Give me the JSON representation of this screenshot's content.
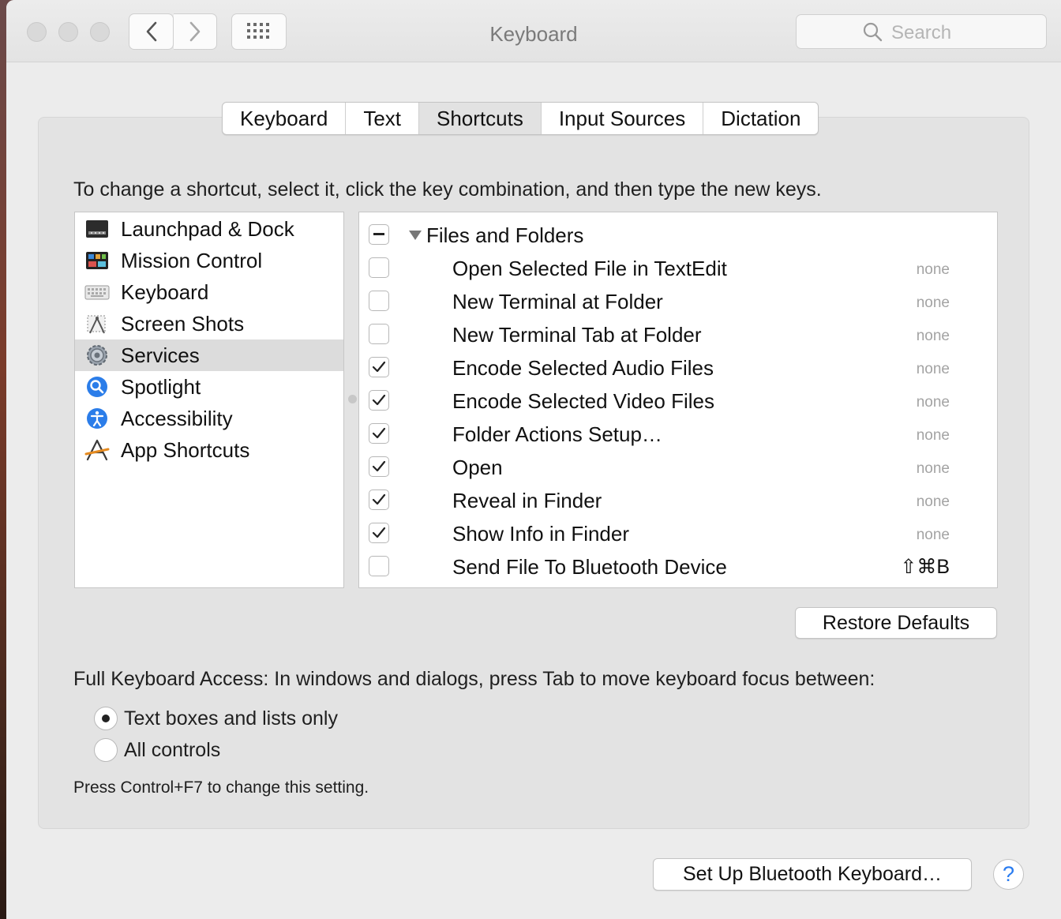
{
  "window": {
    "title": "Keyboard"
  },
  "toolbar": {
    "search_placeholder": "Search",
    "back_icon": "chevron-left-icon",
    "forward_icon": "chevron-right-icon",
    "grid_icon": "grid-icon"
  },
  "tabs": [
    {
      "label": "Keyboard",
      "selected": false
    },
    {
      "label": "Text",
      "selected": false
    },
    {
      "label": "Shortcuts",
      "selected": true
    },
    {
      "label": "Input Sources",
      "selected": false
    },
    {
      "label": "Dictation",
      "selected": false
    }
  ],
  "instructions": "To change a shortcut, select it, click the key combination, and then type the new keys.",
  "categories": [
    {
      "label": "Launchpad & Dock",
      "icon": "launchpad-dock-icon",
      "selected": false
    },
    {
      "label": "Mission Control",
      "icon": "mission-control-icon",
      "selected": false
    },
    {
      "label": "Keyboard",
      "icon": "keyboard-icon",
      "selected": false
    },
    {
      "label": "Screen Shots",
      "icon": "screenshot-icon",
      "selected": false
    },
    {
      "label": "Services",
      "icon": "gear-icon",
      "selected": true
    },
    {
      "label": "Spotlight",
      "icon": "spotlight-icon",
      "selected": false
    },
    {
      "label": "Accessibility",
      "icon": "accessibility-icon",
      "selected": false
    },
    {
      "label": "App Shortcuts",
      "icon": "app-shortcuts-icon",
      "selected": false
    }
  ],
  "shortcuts": {
    "group_label": "Files and Folders",
    "group_state": "mixed",
    "items": [
      {
        "label": "Open Selected File in TextEdit",
        "checked": false,
        "key": "none"
      },
      {
        "label": "New Terminal at Folder",
        "checked": false,
        "key": "none"
      },
      {
        "label": "New Terminal Tab at Folder",
        "checked": false,
        "key": "none"
      },
      {
        "label": "Encode Selected Audio Files",
        "checked": true,
        "key": "none"
      },
      {
        "label": "Encode Selected Video Files",
        "checked": true,
        "key": "none"
      },
      {
        "label": "Folder Actions Setup…",
        "checked": true,
        "key": "none"
      },
      {
        "label": "Open",
        "checked": true,
        "key": "none"
      },
      {
        "label": "Reveal in Finder",
        "checked": true,
        "key": "none"
      },
      {
        "label": "Show Info in Finder",
        "checked": true,
        "key": "none"
      },
      {
        "label": "Send File To Bluetooth Device",
        "checked": false,
        "key": "⇧⌘B"
      }
    ]
  },
  "restore_defaults": "Restore Defaults",
  "full_keyboard_access": {
    "label": "Full Keyboard Access: In windows and dialogs, press Tab to move keyboard focus between:",
    "options": [
      {
        "label": "Text boxes and lists only",
        "selected": true
      },
      {
        "label": "All controls",
        "selected": false
      }
    ],
    "note": "Press Control+F7 to change this setting."
  },
  "bluetooth_button": "Set Up Bluetooth Keyboard…",
  "help_button": "?",
  "colors": {
    "accent": "#2a7cf0",
    "window_bg": "#ececec",
    "selection": "#dcdcdc"
  }
}
